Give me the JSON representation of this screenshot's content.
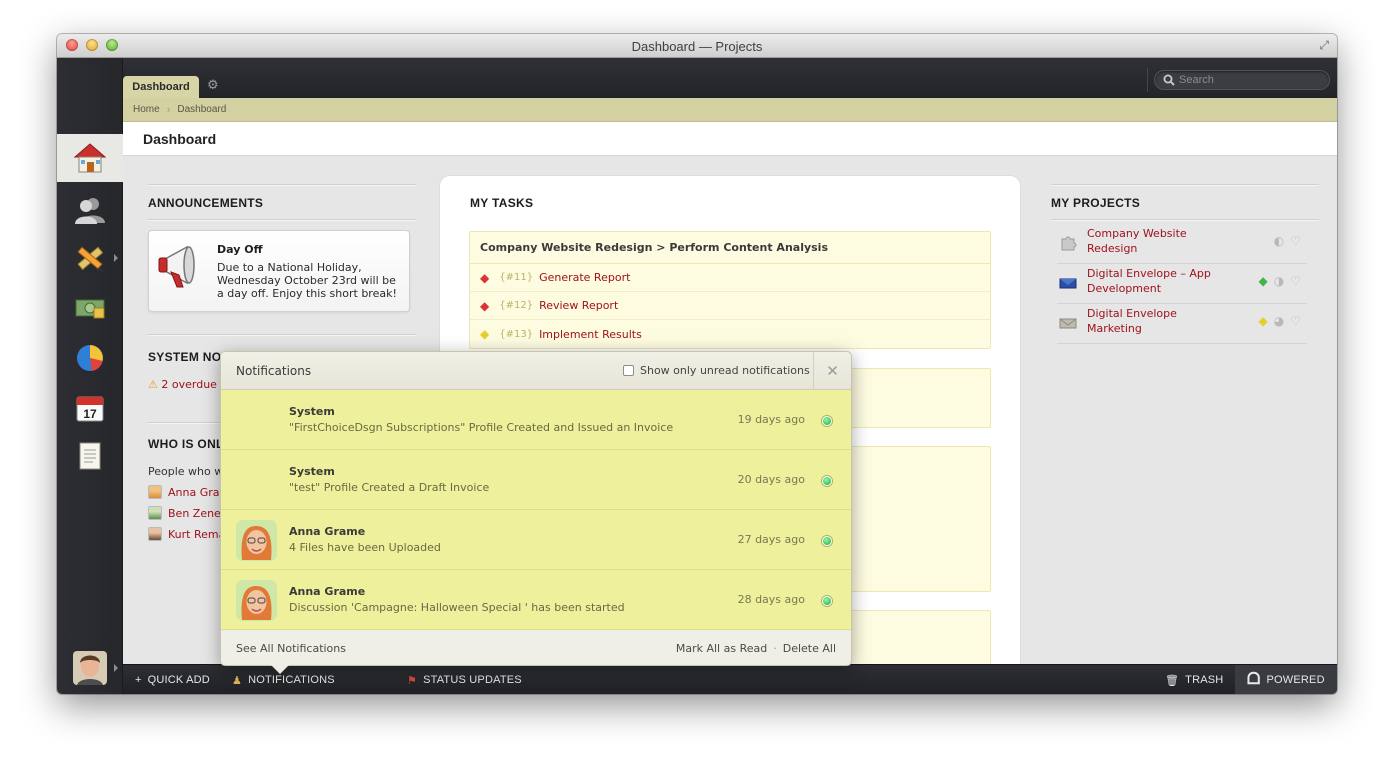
{
  "window": {
    "title": "Dashboard — Projects"
  },
  "topbar": {
    "tab_label": "Dashboard",
    "search_placeholder": "Search"
  },
  "breadcrumb": {
    "home": "Home",
    "current": "Dashboard"
  },
  "page_title": "Dashboard",
  "sidebar": {
    "items": [
      "home-icon",
      "people-icon",
      "pencil-ruler-icon",
      "money-icon",
      "pie-chart-icon",
      "calendar-icon",
      "document-icon"
    ],
    "calendar_day": "17"
  },
  "announcements": {
    "title": "ANNOUNCEMENTS",
    "card_title": "Day Off",
    "card_body": "Due to a National Holiday, Wednesday October 23rd will be a day off. Enjoy this short break!"
  },
  "system_notices": {
    "title": "SYSTEM NOT",
    "alert": "2 overdue"
  },
  "who_is_online": {
    "title": "WHO IS ONL",
    "intro": "People who w",
    "people": [
      "Anna Grar",
      "Ben Zene",
      "Kurt Rema"
    ]
  },
  "tasks": {
    "title": "MY TASKS",
    "group": "Company Website Redesign > Perform Content Analysis",
    "items": [
      {
        "id": "{#11}",
        "name": "Generate Report"
      },
      {
        "id": "{#12}",
        "name": "Review Report"
      },
      {
        "id": "{#13}",
        "name": "Implement Results"
      }
    ]
  },
  "projects": {
    "title": "MY PROJECTS",
    "items": [
      "Company Website Redesign",
      "Digital Envelope – App Development",
      "Digital Envelope Marketing"
    ]
  },
  "bottombar": {
    "quick_add": "QUICK ADD",
    "notifications": "NOTIFICATIONS",
    "status_updates": "STATUS UPDATES",
    "trash": "TRASH",
    "powered": "POWERED"
  },
  "notifications": {
    "title": "Notifications",
    "filter_label": "Show only unread notifications",
    "items": [
      {
        "sender": "System",
        "message": "\"FirstChoiceDsgn Subscriptions\" Profile Created and Issued an Invoice",
        "time": "19 days ago"
      },
      {
        "sender": "System",
        "message": "\"test\" Profile Created a Draft Invoice",
        "time": "20 days ago"
      },
      {
        "sender": "Anna Grame",
        "message": "4 Files have been Uploaded",
        "time": "27 days ago"
      },
      {
        "sender": "Anna Grame",
        "message": "Discussion 'Campagne: Halloween Special ' has been started",
        "time": "28 days ago"
      }
    ],
    "see_all": "See All Notifications",
    "mark_all": "Mark All as Read",
    "separator": "·",
    "delete_all": "Delete All"
  },
  "colors": {
    "accent": "#a0121b",
    "tab": "#d7d4a6",
    "notif_item": "#eff09c",
    "nav_bg": "#2c2e33"
  }
}
